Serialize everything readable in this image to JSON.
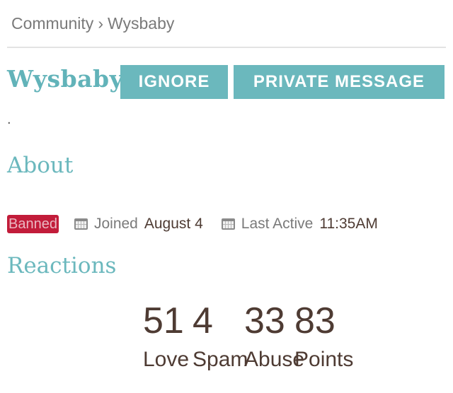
{
  "breadcrumb": {
    "root": "Community",
    "separator": "›",
    "current": "Wysbaby"
  },
  "profile": {
    "username": "Wysbaby",
    "bio": ".",
    "ignore_label": "IGNORE",
    "message_label": "PRIVATE MESSAGE"
  },
  "about": {
    "title": "About",
    "status_badge": "Banned",
    "joined_label": "Joined",
    "joined_value": "August 4",
    "last_active_label": "Last Active",
    "last_active_value": "11:35AM",
    "icons": [
      "calendar-icon",
      "calendar-icon"
    ]
  },
  "reactions": {
    "title": "Reactions",
    "stats": [
      {
        "value": "51",
        "label": "Love"
      },
      {
        "value": "4",
        "label": "Spam"
      },
      {
        "value": "33",
        "label": "Abuse"
      },
      {
        "value": "83",
        "label": "Points"
      }
    ]
  },
  "colors": {
    "accent": "#6bb8bd",
    "banned_badge": "#c21c3a",
    "text_dark": "#4e3b33",
    "text_muted": "#7a7a7a"
  }
}
